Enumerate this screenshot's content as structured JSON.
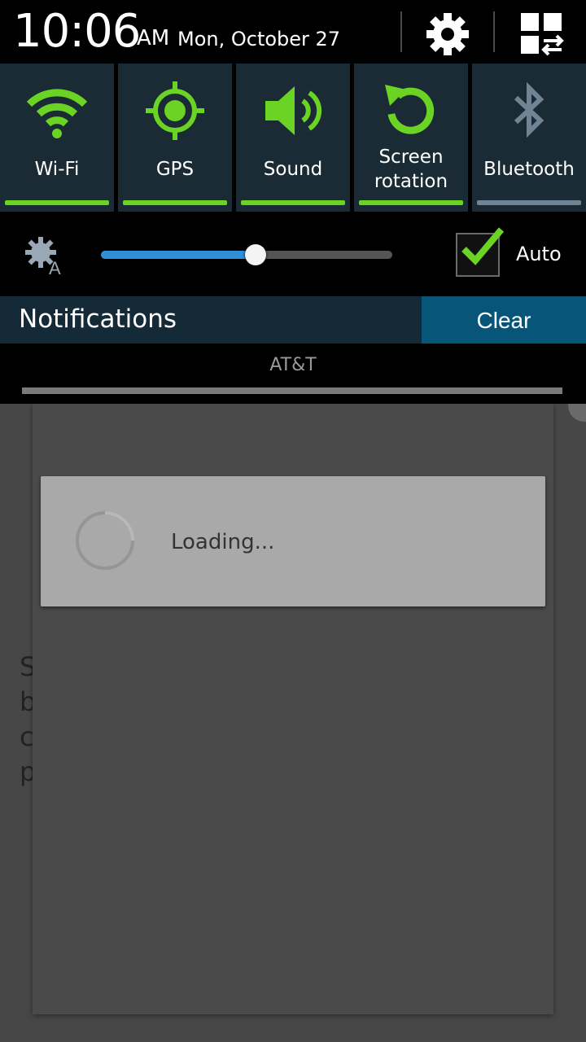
{
  "status": {
    "time": "10:06",
    "ampm": "AM",
    "date": "Mon, October 27",
    "settings_icon": "gear-icon",
    "edit_icon": "grid-edit-icon"
  },
  "quick_settings": [
    {
      "label": "Wi-Fi",
      "icon": "wifi-icon",
      "state": "on"
    },
    {
      "label": "GPS",
      "icon": "gps-icon",
      "state": "on"
    },
    {
      "label": "Sound",
      "icon": "sound-icon",
      "state": "on"
    },
    {
      "label_line1": "Screen",
      "label_line2": "rotation",
      "icon": "rotation-icon",
      "state": "on"
    },
    {
      "label": "Bluetooth",
      "icon": "bluetooth-icon",
      "state": "off"
    }
  ],
  "brightness": {
    "icon": "auto-brightness-icon",
    "level": 0.53,
    "auto_label": "Auto",
    "auto_checked": true
  },
  "notifications": {
    "title": "Notifications",
    "clear_label": "Clear",
    "carrier": "AT&T"
  },
  "background": {
    "letters": [
      "S",
      "b",
      "c",
      "p"
    ]
  },
  "dialog": {
    "text": "Loading..."
  },
  "colors": {
    "accent_on": "#6bd323",
    "accent_off": "#6f8494",
    "slider": "#2e8fd6",
    "header_bg": "#152a37",
    "clear_bg": "#075579"
  }
}
